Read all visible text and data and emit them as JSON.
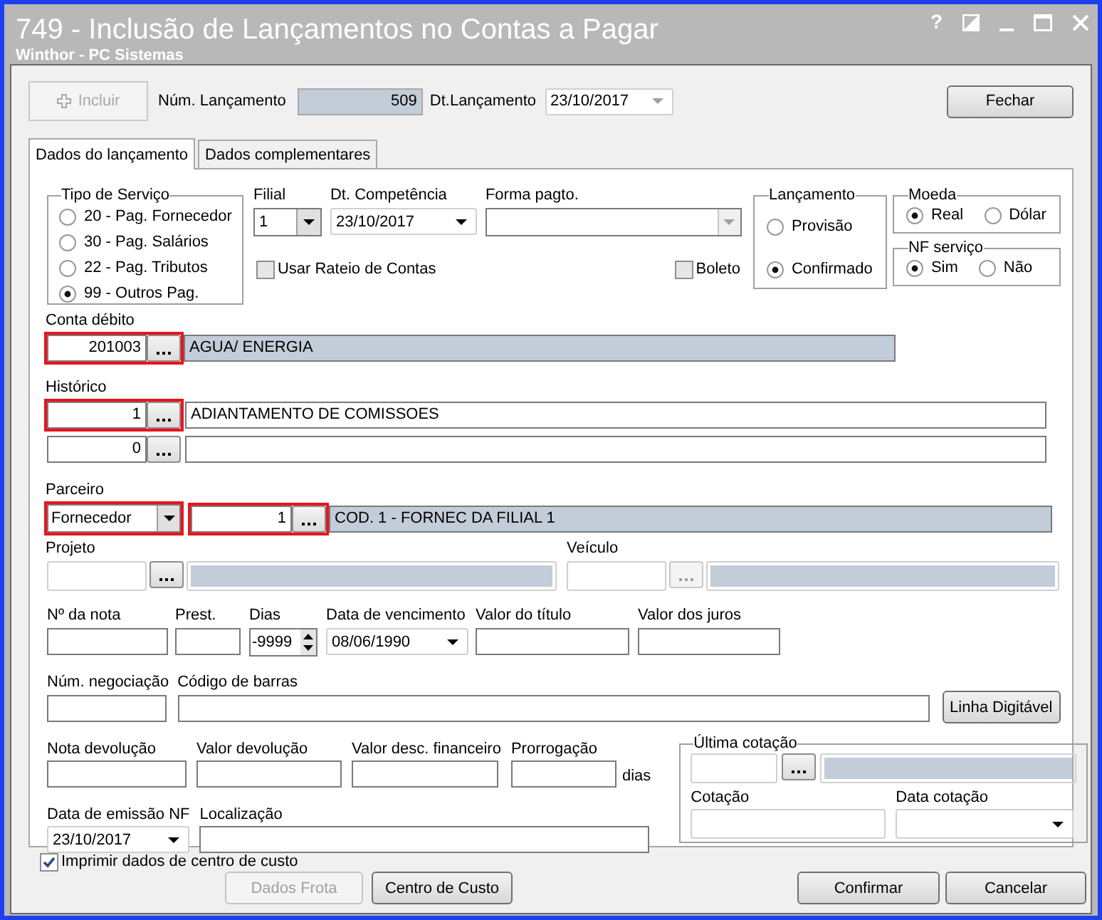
{
  "window": {
    "title": "749 - Inclusão de Lançamentos no Contas a Pagar",
    "subtitle": "Winthor - PC Sistemas",
    "help": "?"
  },
  "toolbar": {
    "add_button": {
      "label": "Incluir",
      "disabled": true
    },
    "number_label": "Núm. Lançamento",
    "number_value": "509",
    "date_label": "Dt.Lançamento",
    "date_value": "23/10/2017",
    "close_button": "Fechar"
  },
  "tabs": [
    {
      "label": "Dados do lançamento",
      "selected": true
    },
    {
      "label": "Dados complementares",
      "selected": false
    }
  ],
  "service_type": {
    "title": "Tipo de Serviço",
    "options": [
      {
        "label": "20 - Pag. Fornecedor",
        "selected": false
      },
      {
        "label": "30 - Pag. Salários",
        "selected": false
      },
      {
        "label": "22 - Pag. Tributos",
        "selected": false
      },
      {
        "label": "99 - Outros Pag.",
        "selected": true
      }
    ]
  },
  "filial": {
    "label": "Filial",
    "value": "1"
  },
  "competencia": {
    "label": "Dt. Competência",
    "value": "23/10/2017"
  },
  "forma_pagto": {
    "label": "Forma pagto."
  },
  "rateio": {
    "label": "Usar Rateio de Contas",
    "checked": false
  },
  "boleto": {
    "label": "Boleto",
    "checked": false
  },
  "lancamento": {
    "title": "Lançamento",
    "options": [
      {
        "label": "Provisão",
        "selected": false
      },
      {
        "label": "Confirmado",
        "selected": true
      }
    ]
  },
  "moeda": {
    "title": "Moeda",
    "options": [
      {
        "label": "Real",
        "selected": true
      },
      {
        "label": "Dólar",
        "selected": false
      }
    ]
  },
  "nf_servico": {
    "title": "NF serviço",
    "options": [
      {
        "label": "Sim",
        "selected": true
      },
      {
        "label": "Não",
        "selected": false
      }
    ]
  },
  "conta_debito": {
    "label": "Conta débito",
    "code": "201003",
    "description": "AGUA/ ENERGIA",
    "highlighted": true
  },
  "historico": {
    "label": "Histórico",
    "rows": [
      {
        "code": "1",
        "description": "ADIANTAMENTO DE COMISSOES",
        "highlighted": true
      },
      {
        "code": "0",
        "highlighted": false
      }
    ]
  },
  "parceiro": {
    "label": "Parceiro",
    "type": "Fornecedor",
    "type_highlighted": true,
    "code": "1",
    "code_highlighted": true,
    "description": "COD. 1 - FORNEC DA FILIAL 1"
  },
  "projeto": {
    "label": "Projeto"
  },
  "veiculo": {
    "label": "Veículo",
    "disabled": true
  },
  "row_nota": {
    "nota": "Nº da nota",
    "prest": "Prest.",
    "dias": "Dias",
    "dias_value": "-9999",
    "vencimento": "Data de vencimento",
    "vencimento_value": "08/06/1990",
    "valor_titulo": "Valor do título",
    "valor_juros": "Valor dos juros"
  },
  "row_negociacao": {
    "negociacao": "Núm. negociação",
    "codigo_barras": "Código de barras",
    "linha_button": "Linha Digitável"
  },
  "row_devolucao": {
    "nota_devolucao": "Nota devolução",
    "valor_devolucao": "Valor devolução",
    "valor_desc": "Valor desc. financeiro",
    "prorrogacao": "Prorrogação",
    "dias_unit": "dias"
  },
  "row_emissao": {
    "emissao": "Data de emissão NF",
    "emissao_value": "23/10/2017",
    "localizacao": "Localização"
  },
  "ultima_cotacao": {
    "title": "Última cotação",
    "cotacao": "Cotação",
    "data_cotacao": "Data cotação"
  },
  "print_checkbox": {
    "label": "Imprimir dados de centro de custo",
    "checked": true
  },
  "buttons": [
    {
      "label": "Dados Frota",
      "disabled": true
    },
    {
      "label": "Centro de Custo",
      "disabled": false
    },
    {
      "label": "Confirmar",
      "disabled": false
    },
    {
      "label": "Cancelar",
      "disabled": false
    }
  ]
}
